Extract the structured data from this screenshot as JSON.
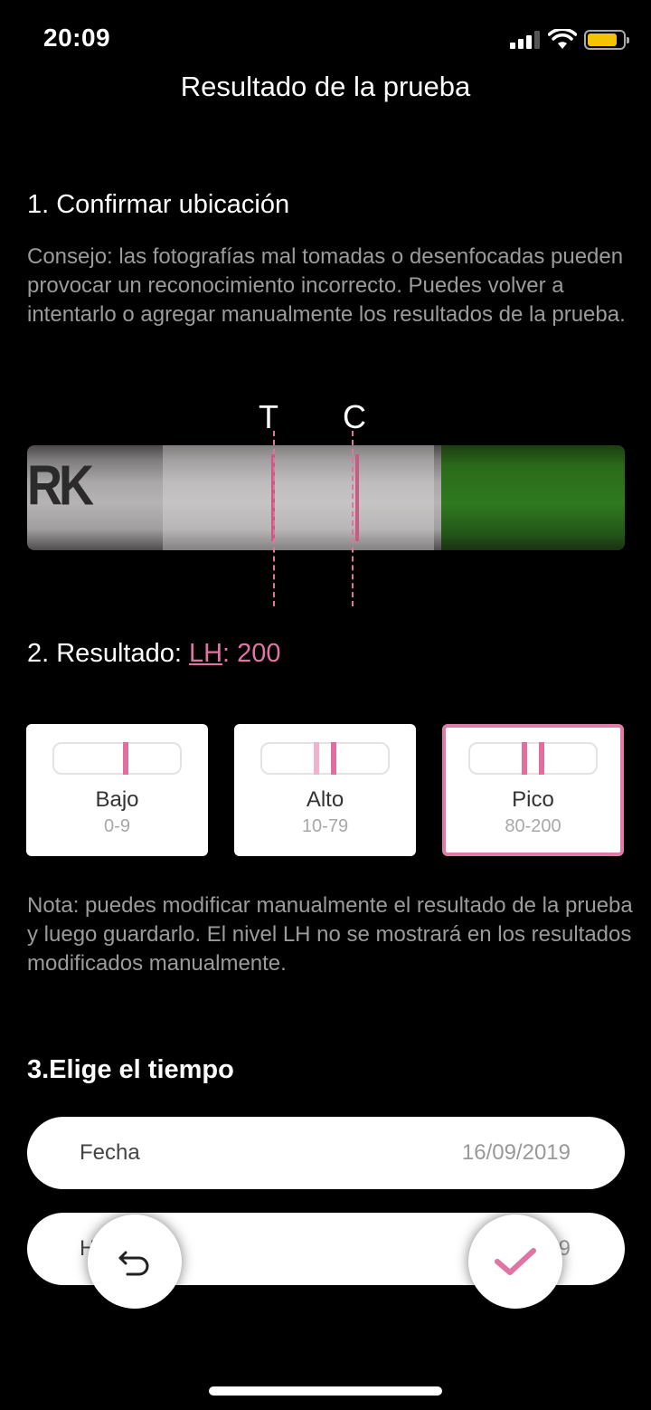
{
  "status": {
    "time": "20:09"
  },
  "header": {
    "title": "Resultado de la prueba"
  },
  "step1": {
    "title": "1. Confirmar ubicación",
    "tip": "Consejo: las fotografías mal tomadas o desenfocadas pueden provocar un reconocimiento incorrecto. Puedes volver a intentarlo o agregar manualmente los resultados de la prueba.",
    "t_label": "T",
    "c_label": "C",
    "strip_mark": "RK"
  },
  "step2": {
    "prefix": "2. Resultado: ",
    "lh_link": "LH",
    "value": ": 200",
    "options": [
      {
        "name": "Bajo",
        "range": "0-9"
      },
      {
        "name": "Alto",
        "range": "10-79"
      },
      {
        "name": "Pico",
        "range": "80-200"
      }
    ],
    "selected": "Pico",
    "note": "Nota: puedes modificar manualmente el resultado de la prueba y luego guardarlo. El nivel LH no se mostrará en los resultados modificados manualmente."
  },
  "step3": {
    "title": "3.Elige el tiempo",
    "date_label": "Fecha",
    "date_value": "16/09/2019",
    "time_label_partial": "H",
    "time_value_partial": "9"
  },
  "colors": {
    "accent": "#e074a4",
    "background": "#000000",
    "card": "#ffffff"
  },
  "icons": {
    "back": "undo-arrow-icon",
    "confirm": "checkmark-icon"
  }
}
